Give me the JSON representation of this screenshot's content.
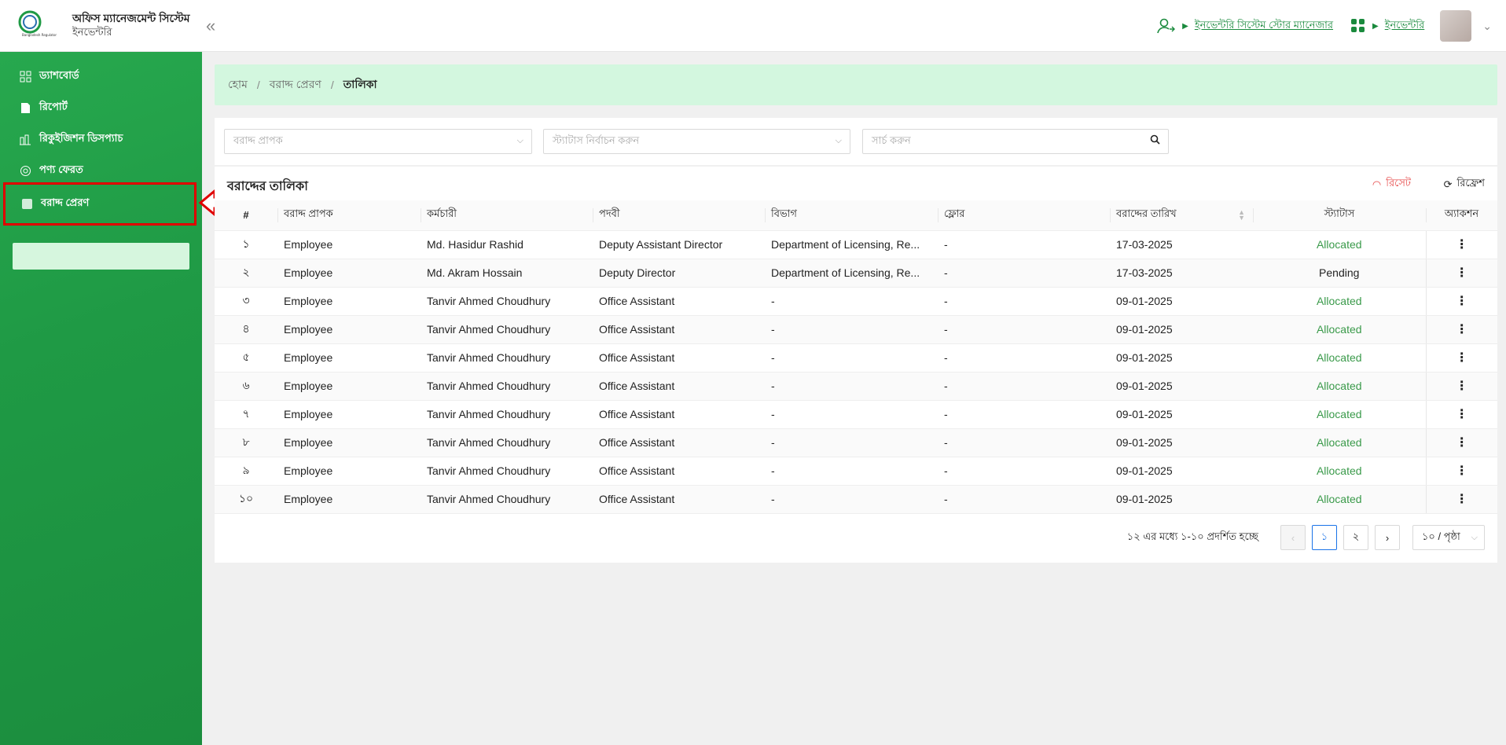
{
  "header": {
    "app_title": "অফিস ম্যানেজমেন্ট সিস্টেম",
    "app_subtitle": "ইনভেন্টরি",
    "logo_text": "Bangladesh Regulatory Authority",
    "role_link": "ইনভেন্টরি সিস্টেম স্টোর ম্যানেজার",
    "module_link": "ইনভেন্টরি"
  },
  "sidebar": {
    "items": [
      {
        "label": "ড্যাশবোর্ড",
        "icon": "grid-icon"
      },
      {
        "label": "রিপোর্ট",
        "icon": "document-icon"
      },
      {
        "label": "রিকুইজিশন ডিসপ্যাচ",
        "icon": "dispatch-icon"
      },
      {
        "label": "পণ্য ফেরত",
        "icon": "return-icon"
      },
      {
        "label": "বরাদ্দ প্রেরণ",
        "icon": "allocation-icon",
        "active": true
      }
    ]
  },
  "breadcrumb": {
    "home": "হোম",
    "section": "বরাদ্দ প্রেরণ",
    "current": "তালিকা"
  },
  "filters": {
    "recipient_placeholder": "বরাদ্দ প্রাপক",
    "status_placeholder": "স্ট্যাটাস নির্বাচন করুন",
    "search_placeholder": "সার্চ করুন"
  },
  "table": {
    "title": "বরাদ্দের তালিকা",
    "reset_label": "রিসেট",
    "refresh_label": "রিফ্রেশ",
    "columns": [
      "#",
      "বরাদ্দ প্রাপক",
      "কর্মচারী",
      "পদবী",
      "বিভাগ",
      "ফ্লোর",
      "বরাদ্দের তারিখ",
      "স্ট্যাটাস",
      "অ্যাকশন"
    ],
    "rows": [
      [
        "১",
        "Employee",
        "Md. Hasidur Rashid",
        "Deputy Assistant Director",
        "Department of Licensing, Re...",
        "-",
        "17-03-2025",
        "Allocated"
      ],
      [
        "২",
        "Employee",
        "Md. Akram Hossain",
        "Deputy Director",
        "Department of Licensing, Re...",
        "-",
        "17-03-2025",
        "Pending"
      ],
      [
        "৩",
        "Employee",
        "Tanvir Ahmed Choudhury",
        "Office Assistant",
        "-",
        "-",
        "09-01-2025",
        "Allocated"
      ],
      [
        "৪",
        "Employee",
        "Tanvir Ahmed Choudhury",
        "Office Assistant",
        "-",
        "-",
        "09-01-2025",
        "Allocated"
      ],
      [
        "৫",
        "Employee",
        "Tanvir Ahmed Choudhury",
        "Office Assistant",
        "-",
        "-",
        "09-01-2025",
        "Allocated"
      ],
      [
        "৬",
        "Employee",
        "Tanvir Ahmed Choudhury",
        "Office Assistant",
        "-",
        "-",
        "09-01-2025",
        "Allocated"
      ],
      [
        "৭",
        "Employee",
        "Tanvir Ahmed Choudhury",
        "Office Assistant",
        "-",
        "-",
        "09-01-2025",
        "Allocated"
      ],
      [
        "৮",
        "Employee",
        "Tanvir Ahmed Choudhury",
        "Office Assistant",
        "-",
        "-",
        "09-01-2025",
        "Allocated"
      ],
      [
        "৯",
        "Employee",
        "Tanvir Ahmed Choudhury",
        "Office Assistant",
        "-",
        "-",
        "09-01-2025",
        "Allocated"
      ],
      [
        "১০",
        "Employee",
        "Tanvir Ahmed Choudhury",
        "Office Assistant",
        "-",
        "-",
        "09-01-2025",
        "Allocated"
      ]
    ],
    "action_glyph": "⋮"
  },
  "pagination": {
    "info": "১২ এর মধ্যে ১-১০ প্রদর্শিত হচ্ছে",
    "prev": "‹",
    "pages": [
      "১",
      "২"
    ],
    "next": "›",
    "page_size": "১০ / পৃষ্ঠা"
  },
  "colors": {
    "brand_green": "#1f9a45",
    "breadcrumb_bg": "#d3f7df",
    "allocated": "#3a9a4a",
    "reset": "#e64545",
    "highlight": "#e00000"
  }
}
